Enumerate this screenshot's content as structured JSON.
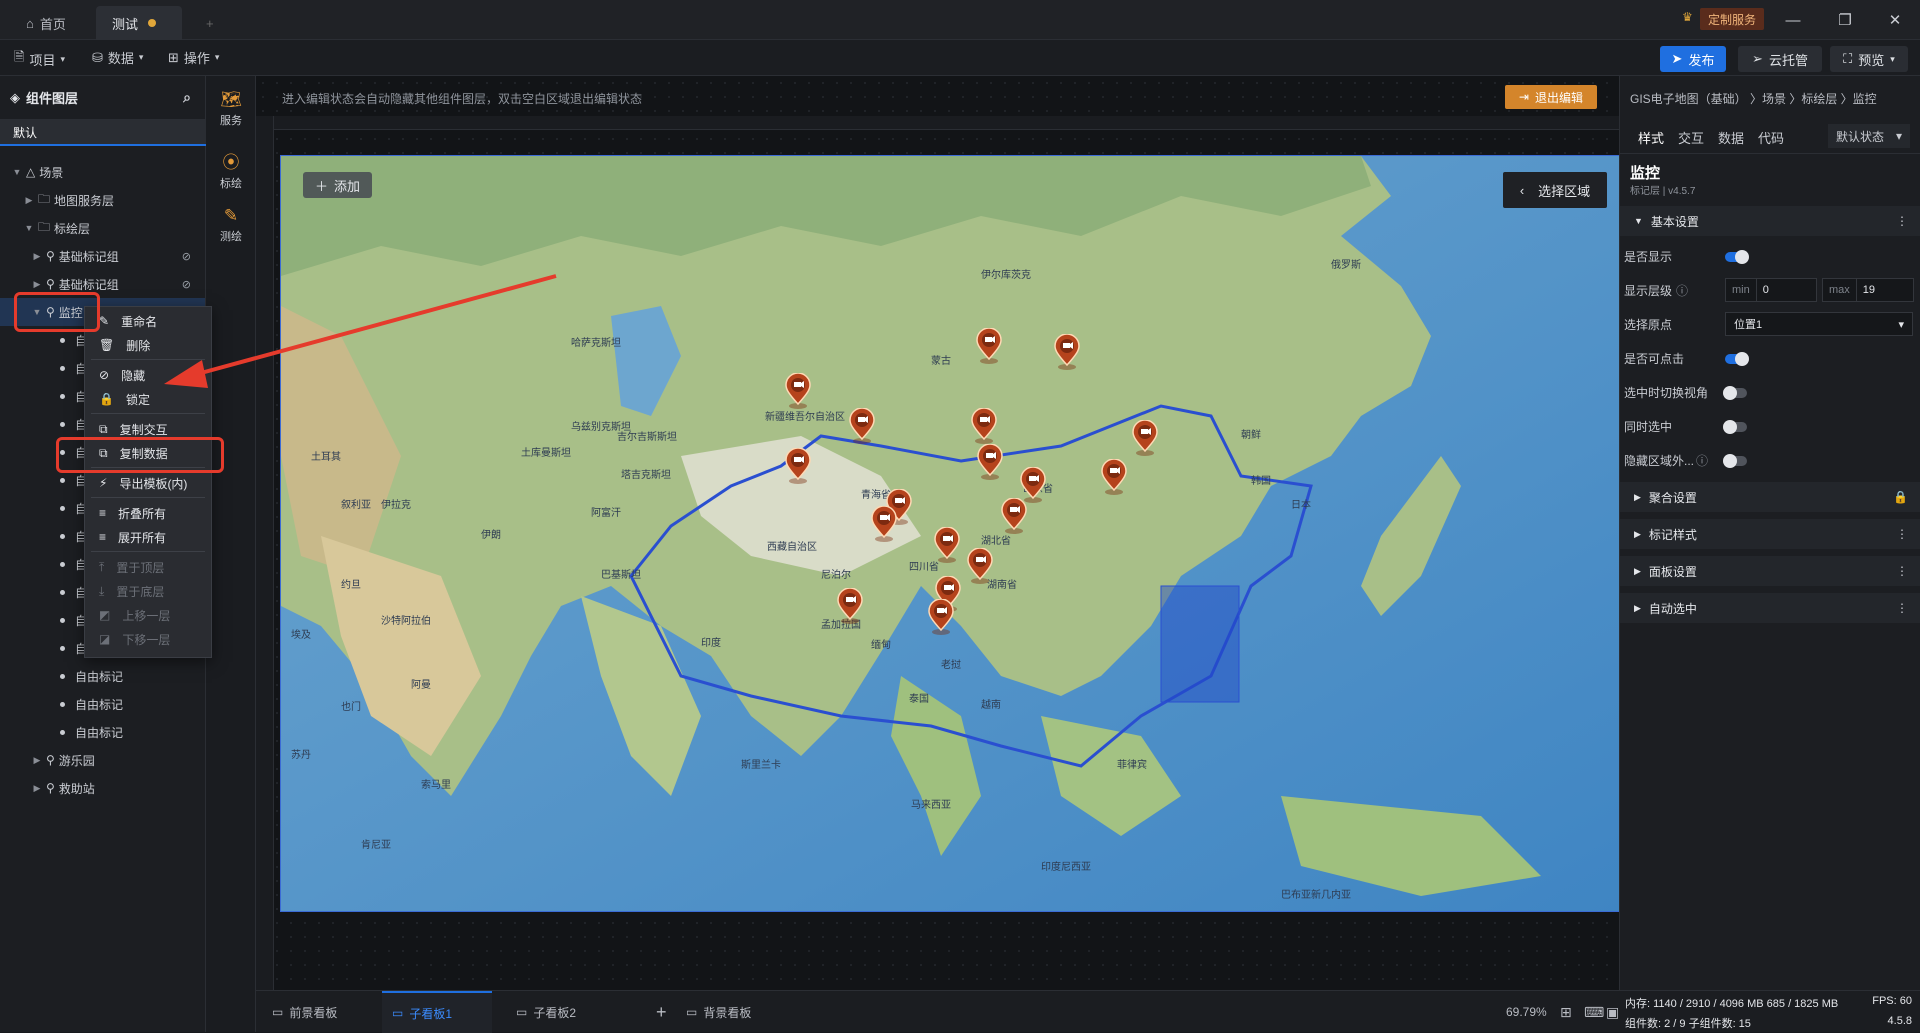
{
  "titlebar": {
    "home_tab": "首页",
    "test_tab": "测试",
    "add_tab": "+",
    "custom_service": "定制服务"
  },
  "toolbar": {
    "project": "项目",
    "data": "数据",
    "operate": "操作",
    "publish": "发布",
    "cloud": "云托管",
    "preview": "预览"
  },
  "layers": {
    "title": "组件图层",
    "default_tab": "默认",
    "tree": [
      {
        "label": "场景"
      },
      {
        "label": "地图服务层"
      },
      {
        "label": "标绘层"
      },
      {
        "label": "基础标记组"
      },
      {
        "label": "基础标记组"
      },
      {
        "label": "监控"
      },
      {
        "label": "自由标记"
      },
      {
        "label": "自由标记"
      },
      {
        "label": "自由标记"
      },
      {
        "label": "游乐园"
      },
      {
        "label": "救助站"
      }
    ],
    "partial": "自"
  },
  "side": {
    "service": "服务",
    "mark": "标绘",
    "measure": "测绘"
  },
  "canvas": {
    "hint": "进入编辑状态会自动隐藏其他组件图层，双击空白区域退出编辑状态",
    "exit": "退出编辑",
    "add": "添加",
    "select_region": "选择区域"
  },
  "map_labels": [
    "新疆维吾尔自治区",
    "青海省",
    "西藏自治区",
    "四川省",
    "湖北省",
    "湖南省",
    "山东省",
    "蒙古",
    "哈萨克斯坦",
    "土库曼斯坦",
    "阿富汗",
    "巴基斯坦",
    "印度",
    "伊朗",
    "伊拉克",
    "沙特阿拉伯",
    "也门",
    "阿曼",
    "缅甸",
    "泰国",
    "老挝",
    "越南",
    "孟加拉国",
    "马来西亚",
    "菲律宾",
    "印度尼西亚",
    "巴布亚新几内亚",
    "日本",
    "韩国",
    "朝鲜",
    "俄罗斯",
    "尼泊尔",
    "吉尔吉斯斯坦",
    "乌兹别克斯坦",
    "塔吉克斯坦",
    "土耳其",
    "叙利亚",
    "约旦",
    "埃及",
    "苏丹",
    "索马里",
    "肯尼亚",
    "斯里兰卡",
    "伊尔库茨克"
  ],
  "context_menu": [
    "重命名",
    "删除",
    "隐藏",
    "锁定",
    "复制交互",
    "复制数据",
    "导出模板(内)",
    "折叠所有",
    "展开所有",
    "置于顶层",
    "置于底层",
    "上移一层",
    "下移一层"
  ],
  "bottom": {
    "tabs": [
      "前景看板",
      "子看板1",
      "子看板2",
      "背景看板"
    ],
    "add": "+",
    "zoom": "69.79%"
  },
  "right": {
    "breadcrumb": "GIS电子地图（基础） 〉场景 〉标绘层 〉监控",
    "tabs": [
      "样式",
      "交互",
      "数据",
      "代码"
    ],
    "state": "默认状态",
    "title": "监控",
    "subtitle": "标记层 | v4.5.7",
    "basic": "基本设置",
    "props": [
      "是否显示",
      "显示层级",
      "选择原点",
      "是否可点击",
      "选中时切换视角",
      "同时选中",
      "隐藏区域外..."
    ],
    "min_label": "min",
    "min_val": "0",
    "max_label": "max",
    "max_val": "19",
    "origin_val": "位置1",
    "sections": [
      "聚合设置",
      "标记样式",
      "面板设置",
      "自动选中"
    ]
  },
  "status": {
    "mem": "内存: 1140 / 2910 / 4096 MB  685 / 1825 MB",
    "fps": "FPS: 60",
    "count": "组件数: 2 / 9  子组件数: 15",
    "ver": "4.5.8"
  }
}
